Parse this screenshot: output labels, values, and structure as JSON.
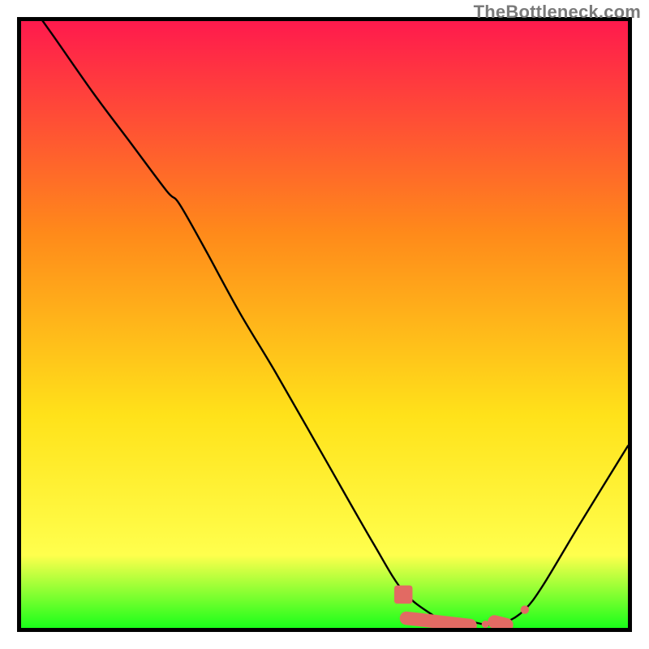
{
  "watermark": "TheBottleneck.com",
  "colors": {
    "border": "#000000",
    "watermark": "#7a7a7a",
    "gradient_top": "#ff1a4d",
    "gradient_mid1": "#ff8a1a",
    "gradient_mid2": "#ffe21a",
    "gradient_mid3": "#ffff4d",
    "gradient_bottom": "#1aff1a",
    "curve": "#000000",
    "markers": "#e26a63"
  },
  "chart_data": {
    "type": "line",
    "title": "",
    "xlabel": "",
    "ylabel": "",
    "xlim": [
      0,
      100
    ],
    "ylim": [
      0,
      100
    ],
    "grid": false,
    "legend": false,
    "series": [
      {
        "name": "curve",
        "x": [
          0,
          5,
          12,
          18,
          24,
          26,
          30,
          36,
          42,
          50,
          58,
          63,
          68,
          70,
          72,
          74,
          77,
          80,
          83,
          86,
          92,
          100
        ],
        "y": [
          105,
          98,
          88,
          80,
          72,
          70,
          63,
          52,
          42,
          28,
          14,
          6,
          2,
          1,
          0.5,
          1,
          0.5,
          1,
          3,
          7,
          17,
          30
        ]
      }
    ],
    "markers": [
      {
        "name": "square-marker",
        "shape": "square",
        "x": 63.0,
        "y": 5.5,
        "size": 3.0
      },
      {
        "name": "segment-marker",
        "shape": "rect",
        "x0": 63.5,
        "y0": 1.6,
        "x1": 74.0,
        "y1": 0.4,
        "thickness": 2.2
      },
      {
        "name": "dot-marker-1",
        "shape": "circle",
        "x": 76.5,
        "y": 0.6,
        "size": 1.2
      },
      {
        "name": "segment-marker-2",
        "shape": "rect",
        "x0": 78.0,
        "y0": 1.0,
        "x1": 80.0,
        "y1": 0.5,
        "thickness": 2.2
      },
      {
        "name": "dot-marker-2",
        "shape": "circle",
        "x": 83.0,
        "y": 3.0,
        "size": 1.4
      }
    ]
  }
}
